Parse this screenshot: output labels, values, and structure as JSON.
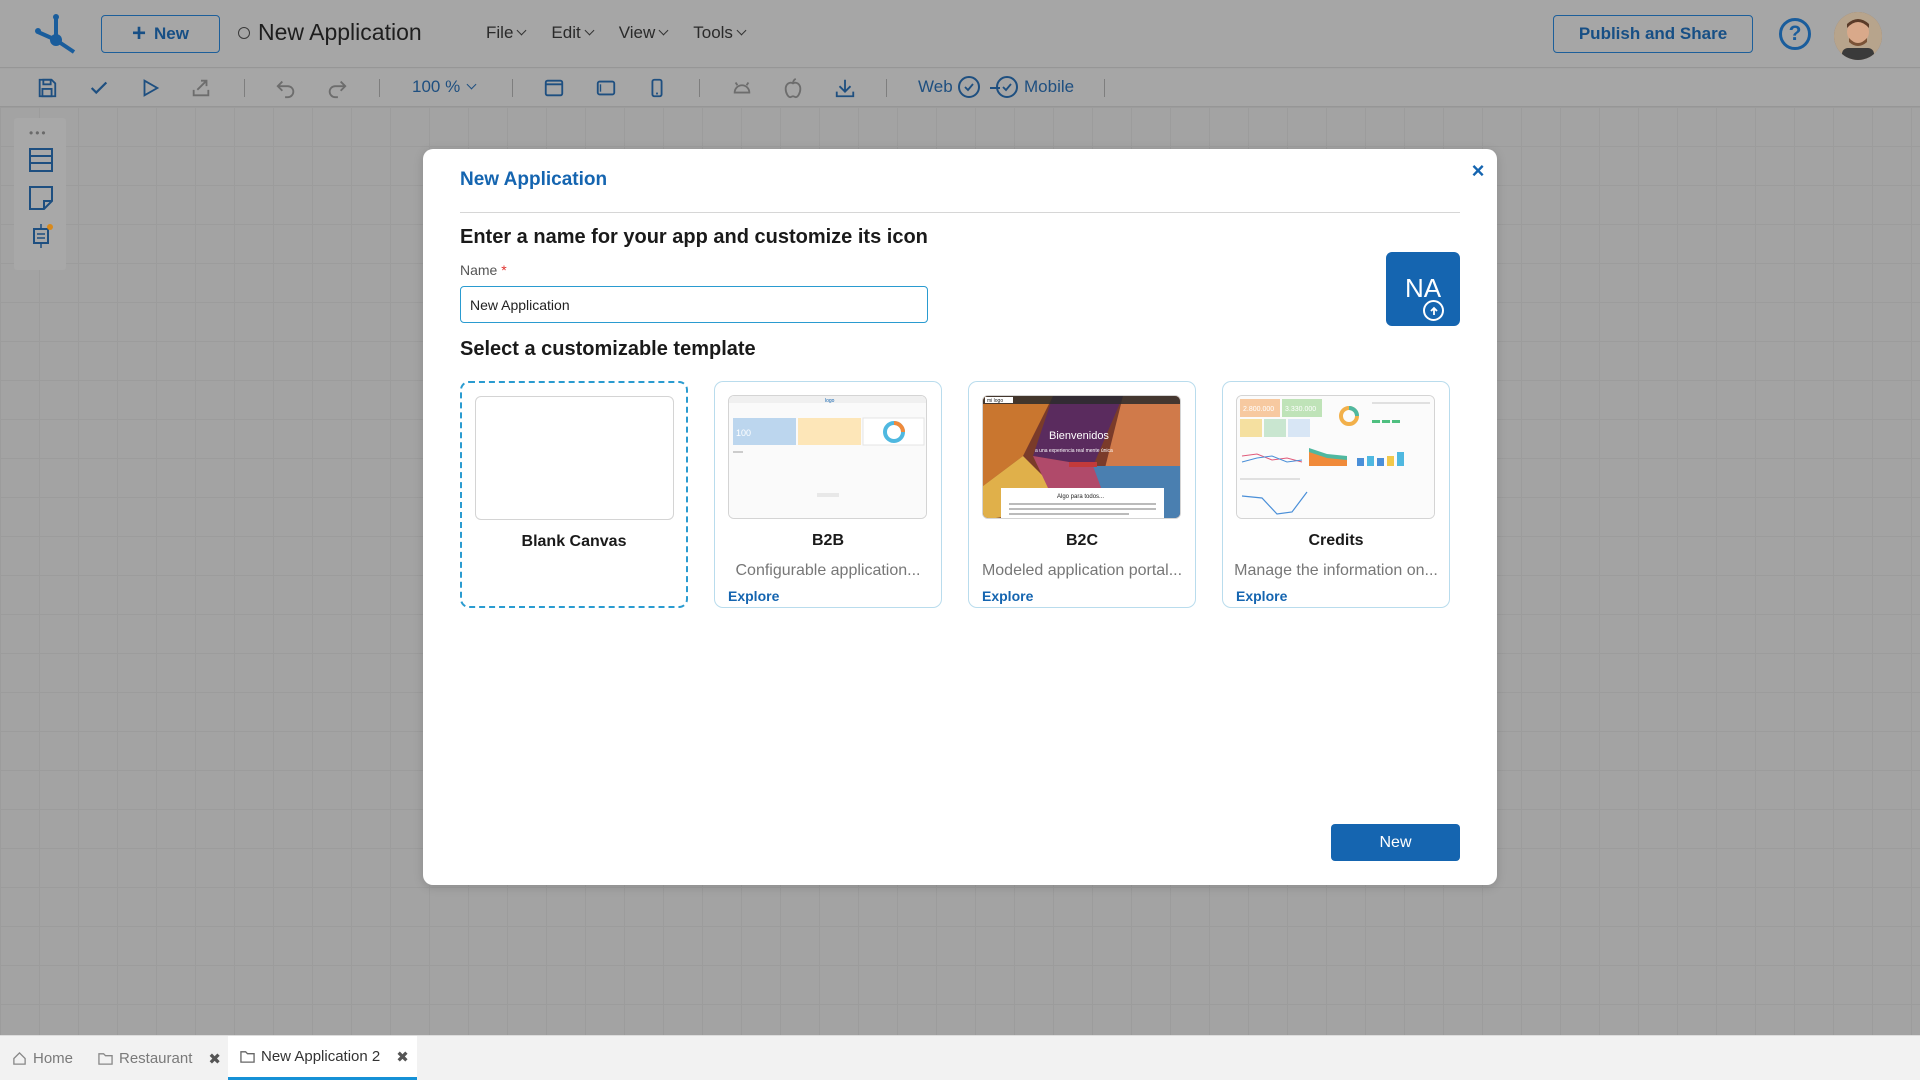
{
  "header": {
    "new_button_label": "New",
    "app_title": "New Application",
    "menus": [
      "File",
      "Edit",
      "View",
      "Tools"
    ],
    "publish_label": "Publish and Share",
    "help_symbol": "?"
  },
  "toolbar": {
    "zoom": "100 %",
    "web_label": "Web",
    "mobile_label": "Mobile",
    "icons": [
      "save-icon",
      "check-icon",
      "play-icon",
      "export-icon",
      "undo-icon",
      "redo-icon",
      "desktop-view-icon",
      "tablet-view-icon",
      "mobile-view-icon",
      "android-icon",
      "apple-icon",
      "download-icon"
    ]
  },
  "palette": {
    "dots": "•••",
    "icons": [
      "layout-icon",
      "note-icon",
      "component-icon"
    ]
  },
  "modal": {
    "title": "New Application",
    "close_symbol": "×",
    "name_heading": "Enter a name for your app and customize its icon",
    "name_label": "Name",
    "required_mark": "*",
    "name_value": "New Application",
    "icon_initials": "NA",
    "template_heading": "Select a customizable template",
    "templates": [
      {
        "name": "Blank Canvas",
        "description": "",
        "explore": ""
      },
      {
        "name": "B2B",
        "description": "Configurable application...",
        "explore": "Explore"
      },
      {
        "name": "B2C",
        "description": "Modeled application portal...",
        "explore": "Explore"
      },
      {
        "name": "Credits",
        "description": "Manage the information on...",
        "explore": "Explore"
      }
    ],
    "thumb_b2b": {
      "logo": "logo",
      "metric": "100"
    },
    "thumb_b2c": {
      "logo": "mi logo",
      "headline": "Bienvenidos",
      "tagline": "a una experiencia real mente única",
      "panel_title": "Algo para todos..."
    },
    "thumb_credits": {
      "kpi_1": "2.800.000",
      "kpi_2": "3.330.000"
    },
    "create_label": "New"
  },
  "bottom_tabs": [
    {
      "label": "Home",
      "closable": false,
      "active": false
    },
    {
      "label": "Restaurant",
      "closable": true,
      "active": false
    },
    {
      "label": "New Application 2",
      "closable": true,
      "active": true
    }
  ],
  "colors": {
    "accent": "#1565b0",
    "input_focus": "#2a9bd0",
    "required": "#e0322e",
    "active_tab": "#1591d6"
  }
}
